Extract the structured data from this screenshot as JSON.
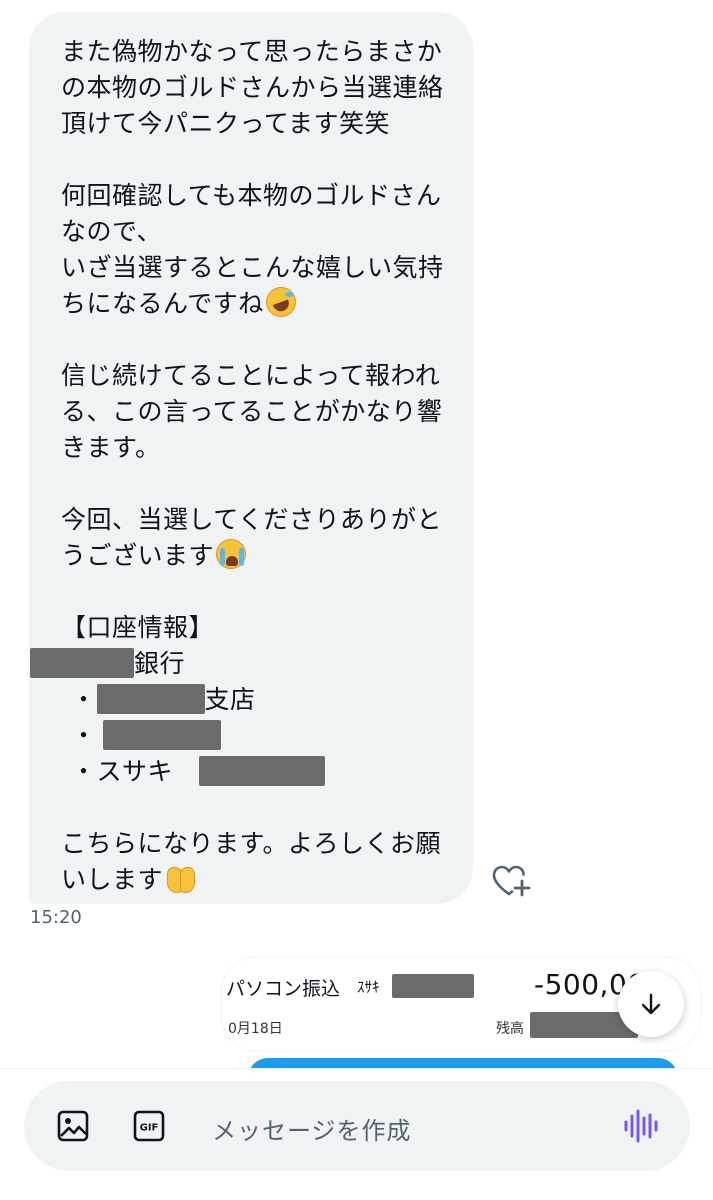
{
  "message": {
    "lines": [
      "また偽物かなって思ったらまさか",
      "の本物のゴルドさんから当選連絡",
      "頂けて今パニクってます笑笑",
      "何回確認しても本物のゴルドさん",
      "なので、",
      "いざ当選するとこんな嬉しい気持",
      "ちになるんですね",
      "信じ続けてることによって報われ",
      "る、この言ってることがかなり響",
      "きます。",
      "今回、当選してくださりありがと",
      "うございます",
      "【口座情報】",
      "銀行",
      "・",
      "支店",
      "・",
      "・スサキ",
      "こちらになります。よろしくお願",
      "いします"
    ],
    "emojis": [
      "rolling-on-floor-laughing",
      "loudly-crying",
      "palms-up-together"
    ],
    "timestamp": "15:20"
  },
  "transfer": {
    "label": "パソコン振込",
    "kana": "ｽｻｷ",
    "amount": "-500,00",
    "date": "0月18日",
    "balance_label": "残高"
  },
  "composer": {
    "placeholder": "メッセージを作成",
    "gif_label": "GIF"
  },
  "icons": {
    "react": "heart-plus-icon",
    "scroll": "arrow-down-icon",
    "image": "image-icon",
    "gif": "gif-icon",
    "voice": "voice-wave-icon"
  },
  "colors": {
    "bubble": "#eff3f4",
    "accent_blue": "#1d9bf0",
    "voice_purple": "#7856ff",
    "redaction": "#6b6b6b"
  }
}
